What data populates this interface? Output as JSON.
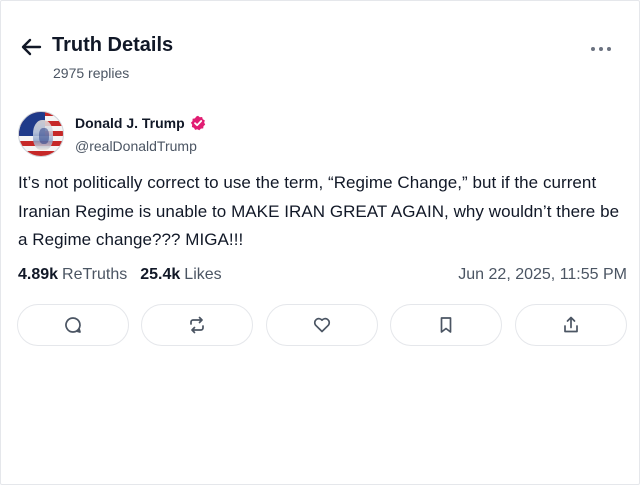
{
  "header": {
    "title": "Truth Details",
    "replies": "2975 replies"
  },
  "post": {
    "author_name": "Donald J. Trump",
    "handle": "@realDonaldTrump",
    "text": "It’s not politically correct to use the term, “Regime Change,” but if the current Iranian Regime is unable to MAKE IRAN GREAT AGAIN, why wouldn’t there be a Regime change??? MIGA!!!",
    "retruths_count": "4.89k",
    "retruths_label": "ReTruths",
    "likes_count": "25.4k",
    "likes_label": "Likes",
    "timestamp": "Jun 22, 2025, 11:55 PM"
  },
  "icons": {
    "back": "arrow-left-icon",
    "more": "ellipsis-icon",
    "verified": "verified-badge-icon",
    "reply": "comment-icon",
    "retruth": "repost-icon",
    "like": "heart-icon",
    "bookmark": "bookmark-icon",
    "share": "share-icon"
  },
  "colors": {
    "verified": "#e11d72",
    "text": "#111827",
    "muted": "#4b5563",
    "border": "#e5e7eb",
    "icon": "#4b5563"
  }
}
